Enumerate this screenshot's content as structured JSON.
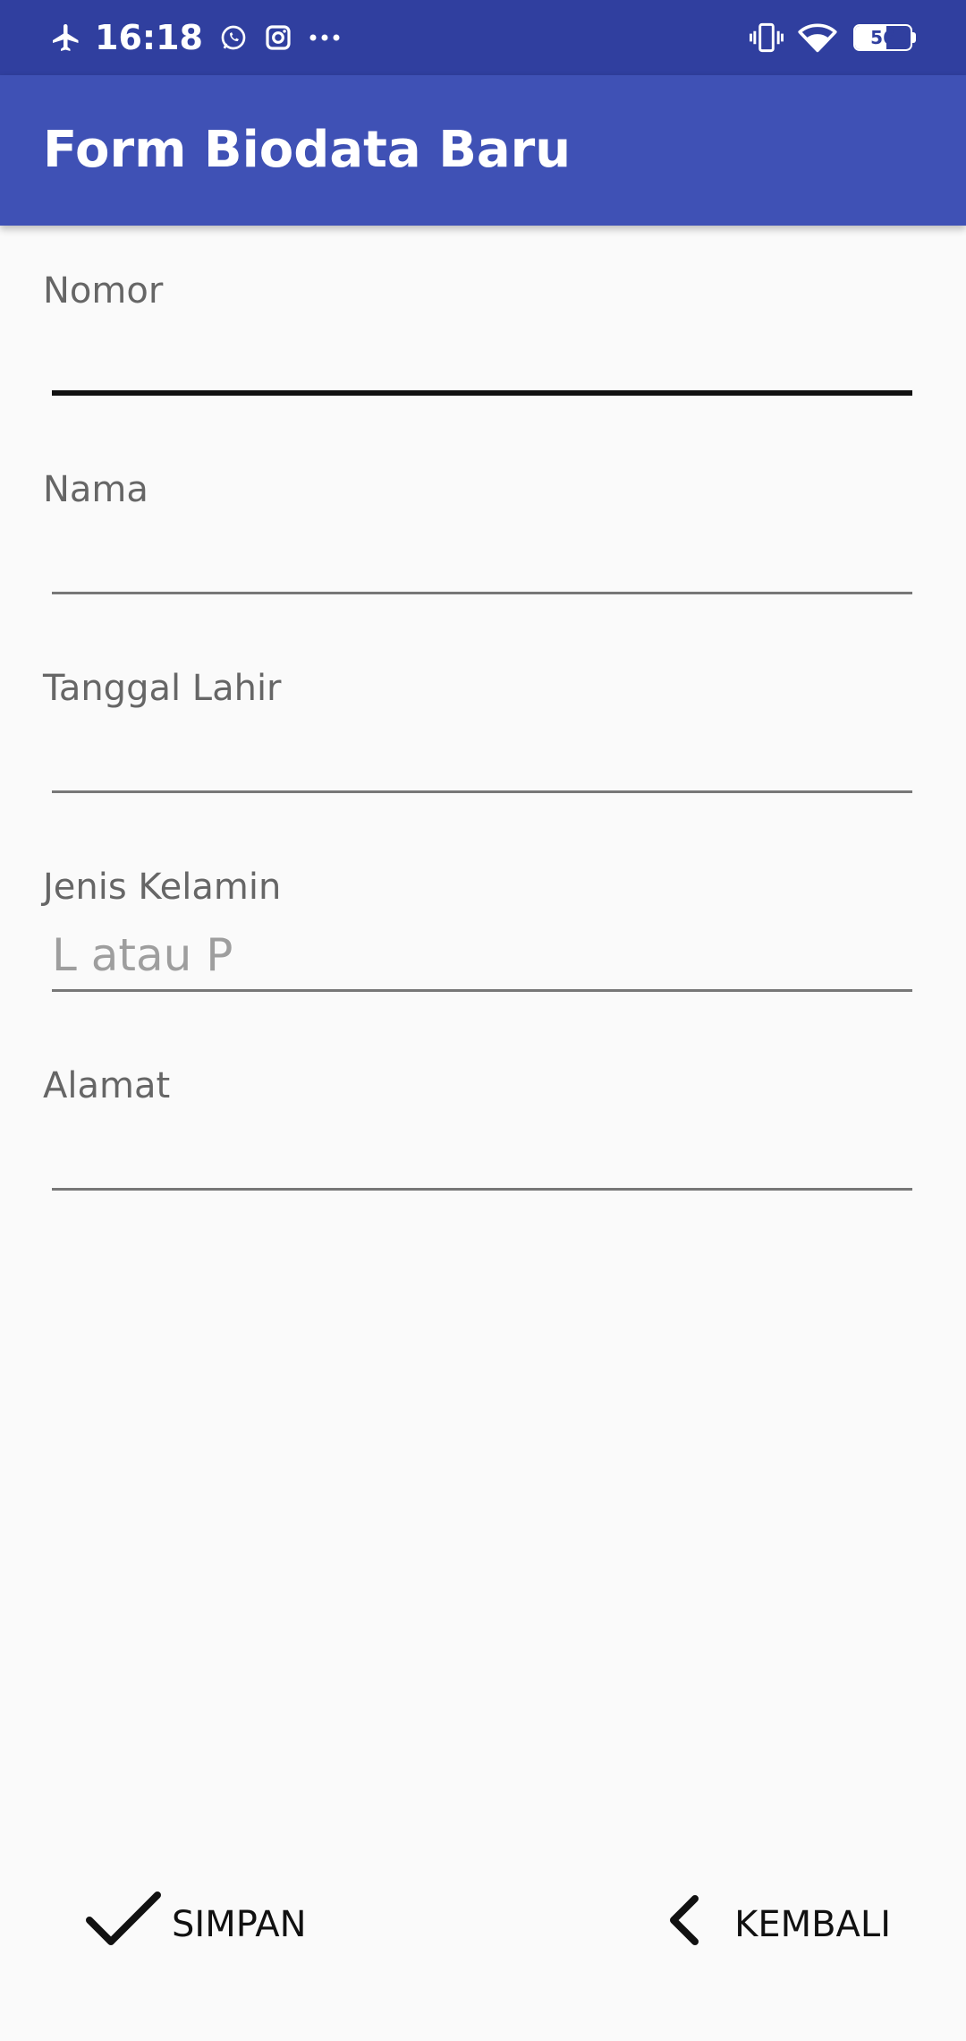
{
  "status_bar": {
    "time": "16:18",
    "battery_level": "56",
    "battery_fraction": 0.56,
    "icons": [
      "airplane-icon",
      "whatsapp-icon",
      "instagram-icon",
      "more-dots-icon",
      "vibrate-icon",
      "wifi-icon",
      "battery-icon"
    ]
  },
  "app_bar": {
    "title": "Form Biodata Baru"
  },
  "form": {
    "fields": [
      {
        "label": "Nomor",
        "value": "",
        "placeholder": ""
      },
      {
        "label": "Nama",
        "value": "",
        "placeholder": ""
      },
      {
        "label": "Tanggal Lahir",
        "value": "",
        "placeholder": ""
      },
      {
        "label": "Jenis Kelamin",
        "value": "",
        "placeholder": "L atau P"
      },
      {
        "label": "Alamat",
        "value": "",
        "placeholder": ""
      }
    ]
  },
  "actions": {
    "save_label": "SIMPAN",
    "back_label": "KEMBALI",
    "save_icon": "check-icon",
    "back_icon": "chevron-left-icon"
  },
  "colors": {
    "status_bar": "#303f9f",
    "app_bar": "#3f51b5",
    "background": "#fafafa"
  }
}
